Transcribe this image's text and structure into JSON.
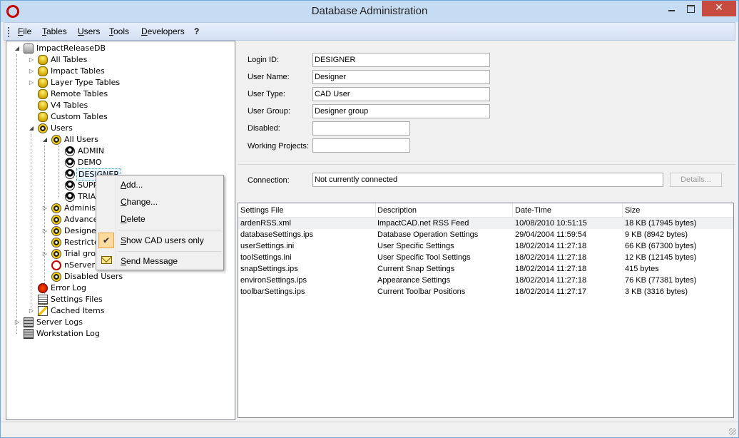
{
  "window": {
    "title": "Database Administration",
    "close_glyph": "✕"
  },
  "menu": [
    "File",
    "Tables",
    "Users",
    "Tools",
    "Developers",
    "?"
  ],
  "tree": {
    "root": "ImpactReleaseDB",
    "tables": [
      "All Tables",
      "Impact Tables",
      "Layer Type Tables",
      "Remote Tables",
      "V4 Tables",
      "Custom Tables"
    ],
    "users_label": "Users",
    "all_users_label": "All Users",
    "users": [
      "ADMIN",
      "DEMO",
      "DESIGNER",
      "SUPP",
      "TRIA"
    ],
    "groups": [
      "Administ",
      "Advance",
      "Designer",
      "Restricte",
      "Trial grou"
    ],
    "nserver": "nServer",
    "disabled_users": "Disabled Users",
    "error_log": "Error Log",
    "settings_files": "Settings Files",
    "cached_items": "Cached Items",
    "server_logs": "Server Logs",
    "workstation_log": "Workstation Log"
  },
  "form": {
    "login_id_label": "Login ID:",
    "login_id": "DESIGNER",
    "user_name_label": "User Name:",
    "user_name": "Designer",
    "user_type_label": "User Type:",
    "user_type": "CAD User",
    "user_group_label": "User Group:",
    "user_group": "Designer group",
    "disabled_label": "Disabled:",
    "disabled": "",
    "working_projects_label": "Working Projects:",
    "working_projects": "",
    "connection_label": "Connection:",
    "connection": "Not currently connected",
    "details_button": "Details..."
  },
  "list": {
    "columns": [
      "Settings File",
      "Description",
      "Date-Time",
      "Size"
    ],
    "rows": [
      [
        "ardenRSS.xml",
        "ImpactCAD.net RSS Feed",
        "10/08/2010 10:51:15",
        "18 KB (17945 bytes)"
      ],
      [
        "databaseSettings.ips",
        "Database Operation Settings",
        "29/04/2004 11:59:54",
        "9 KB (8942 bytes)"
      ],
      [
        "userSettings.ini",
        "User Specific Settings",
        "18/02/2014 11:27:18",
        "66 KB (67300 bytes)"
      ],
      [
        "toolSettings.ini",
        "User Specific Tool Settings",
        "18/02/2014 11:27:18",
        "12 KB (12145 bytes)"
      ],
      [
        "snapSettings.ips",
        "Current Snap Settings",
        "18/02/2014 11:27:18",
        "415 bytes"
      ],
      [
        "environSettings.ips",
        "Appearance Settings",
        "18/02/2014 11:27:18",
        "76 KB (77381 bytes)"
      ],
      [
        "toolbarSettings.ips",
        "Current Toolbar Positions",
        "18/02/2014 11:27:17",
        "3 KB (3316 bytes)"
      ]
    ]
  },
  "context_menu": {
    "add": "Add...",
    "change": "Change...",
    "delete": "Delete",
    "show_cad": "Show CAD users only",
    "send_message": "Send Message",
    "check_glyph": "✔"
  }
}
